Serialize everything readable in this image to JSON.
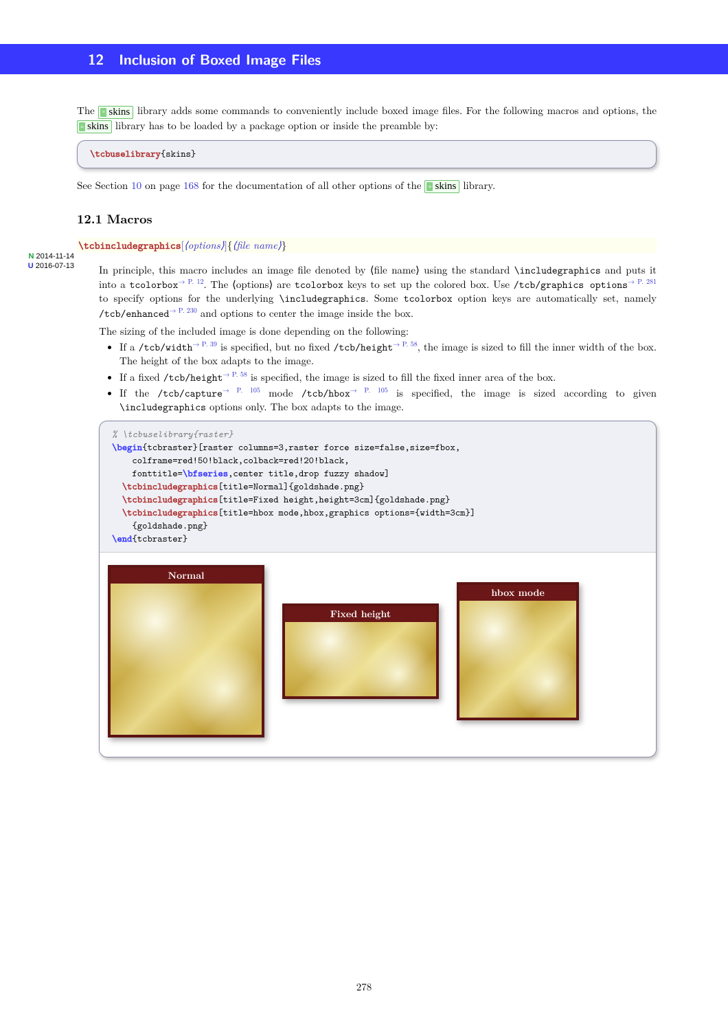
{
  "header": {
    "number": "12",
    "title": "Inclusion of Boxed Image Files"
  },
  "skins_label": "skins",
  "para1a": "The ",
  "para1b": " library adds some commands to conveniently include boxed image files. For the following macros and options, the ",
  "para1c": " library has to be loaded by a package option or inside the preamble by:",
  "code1": {
    "cmd": "\\tcbuselibrary",
    "arg": "{skins}"
  },
  "para2a": "See Section ",
  "para2_sec": "10",
  "para2b": " on page ",
  "para2_pg": "168",
  "para2c": " for the documentation of all other options of the ",
  "para2d": " library.",
  "subsec": "12.1   Macros",
  "badges": {
    "new": "N 2014-11-14",
    "upd": "U 2016-07-13"
  },
  "cmddef": {
    "name": "\\tcbincludegraphics",
    "optl": "[",
    "opt": "options",
    "optr": "]",
    "argl": "{",
    "arg": "file name",
    "argr": "}"
  },
  "desc": {
    "p1": "In principle, this macro includes an image file denoted by ⟨file name⟩ using the standard ",
    "incg": "\\includegraphics",
    "p2": " and puts it into a ",
    "tcb": "tcolorbox",
    "ref_p12": "→ P. 12",
    "p3": ". The ⟨options⟩ are ",
    "p4": " keys to set up the colored box. Use ",
    "gopt": "/tcb/graphics options",
    "ref_p281": "→ P. 281",
    "p5": " to specify options for the underlying ",
    "p6": ". Some ",
    "p7": " option keys are automatically set, namely ",
    "enh": "/tcb/enhanced",
    "ref_p230": "→ P. 230",
    "p8": " and options to center the image inside the box.",
    "sizing": "The sizing of the included image is done depending on the following:",
    "b1a": "If a ",
    "width": "/tcb/width",
    "ref_p39": "→ P. 39",
    "b1b": " is specified, but no fixed ",
    "height": "/tcb/height",
    "ref_p58": "→ P. 58",
    "b1c": ", the image is sized to fill the inner width of the box. The height of the box adapts to the image.",
    "b2a": "If a fixed ",
    "b2b": " is specified, the image is sized to fill the fixed inner area of the box.",
    "b3a": "If the ",
    "capture": "/tcb/capture",
    "ref_p105a": "→ P. 105",
    "b3b": " mode ",
    "hbox": "/tcb/hbox",
    "ref_p105b": "→ P. 105",
    "b3c": " is specified, the image is sized according to given ",
    "b3d": " options only. The box adapts to the image."
  },
  "code2": {
    "l1": "% \\tcbuselibrary{raster}",
    "l2a": "\\begin",
    "l2b": "{tcbraster}",
    "l2c": "[raster columns=3,raster force size=false,size=fbox,",
    "l3": "    colframe=red!50!black,colback=red!20!black,",
    "l4a": "    fonttitle=",
    "l4b": "\\bfseries",
    "l4c": ",center title,drop fuzzy shadow]",
    "l5a": "  \\tcbincludegraphics",
    "l5b": "[title=Normal]{goldshade.png}",
    "l6a": "  \\tcbincludegraphics",
    "l6b": "[title=Fixed height,height=3cm]{goldshade.png}",
    "l7a": "  \\tcbincludegraphics",
    "l7b": "[title=hbox mode,hbox,graphics options={width=3cm}]",
    "l8": "    {goldshade.png}",
    "l9a": "\\end",
    "l9b": "{tcbraster}"
  },
  "example_titles": {
    "t1": "Normal",
    "t2": "Fixed height",
    "t3": "hbox mode"
  },
  "page_number": "278"
}
